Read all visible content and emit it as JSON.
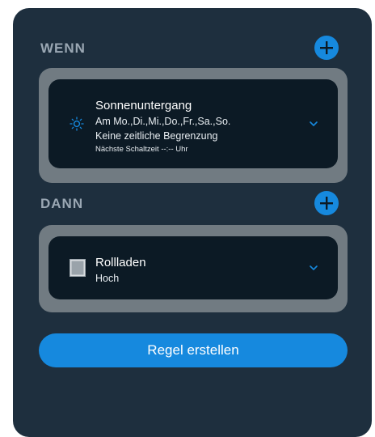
{
  "colors": {
    "background": "#1e2f3e",
    "accent": "#1689de",
    "group": "#717b82",
    "card": "#0c1a25"
  },
  "wenn": {
    "title": "WENN",
    "add_icon": "plus-icon",
    "card": {
      "icon": "sunset-icon",
      "title": "Sonnenuntergang",
      "days": "Am Mo.,Di.,Mi.,Do.,Fr.,Sa.,So.",
      "limit": "Keine zeitliche Begrenzung",
      "next": "Nächste Schaltzeit --:-- Uhr",
      "expand_icon": "chevron-down-icon"
    }
  },
  "dann": {
    "title": "DANN",
    "add_icon": "plus-icon",
    "card": {
      "icon": "shutter-icon",
      "title": "Rollladen",
      "state": "Hoch",
      "expand_icon": "chevron-down-icon"
    }
  },
  "create_button": {
    "label": "Regel erstellen"
  }
}
